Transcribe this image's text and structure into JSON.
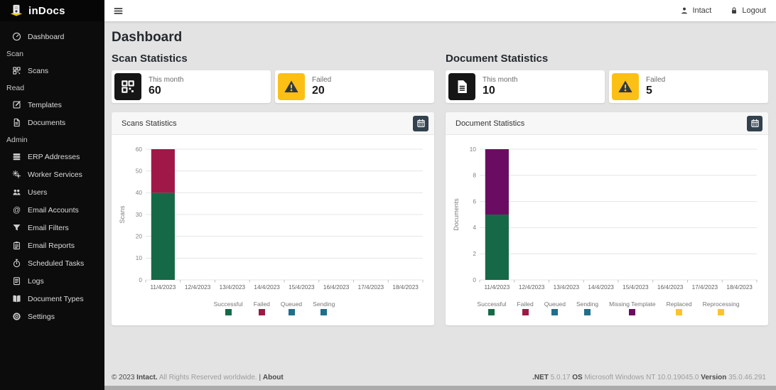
{
  "app": {
    "logo_text": "inDocs"
  },
  "topbar": {
    "user_label": "Intact",
    "logout_label": "Logout"
  },
  "sidebar": {
    "items": [
      {
        "type": "link",
        "label": "Dashboard",
        "icon": "speedometer"
      },
      {
        "type": "section",
        "label": "Scan"
      },
      {
        "type": "link",
        "label": "Scans",
        "icon": "qr-code"
      },
      {
        "type": "section",
        "label": "Read"
      },
      {
        "type": "link",
        "label": "Templates",
        "icon": "pencil-square"
      },
      {
        "type": "link",
        "label": "Documents",
        "icon": "file"
      },
      {
        "type": "section",
        "label": "Admin"
      },
      {
        "type": "link",
        "label": "ERP Addresses",
        "icon": "server"
      },
      {
        "type": "link",
        "label": "Worker Services",
        "icon": "gears"
      },
      {
        "type": "link",
        "label": "Users",
        "icon": "people"
      },
      {
        "type": "link",
        "label": "Email Accounts",
        "icon": "at"
      },
      {
        "type": "link",
        "label": "Email Filters",
        "icon": "funnel"
      },
      {
        "type": "link",
        "label": "Email Reports",
        "icon": "clipboard"
      },
      {
        "type": "link",
        "label": "Scheduled Tasks",
        "icon": "stopwatch"
      },
      {
        "type": "link",
        "label": "Logs",
        "icon": "journal"
      },
      {
        "type": "link",
        "label": "Document Types",
        "icon": "book"
      },
      {
        "type": "link",
        "label": "Settings",
        "icon": "gear"
      }
    ]
  },
  "page": {
    "title": "Dashboard"
  },
  "scan": {
    "heading": "Scan Statistics",
    "cards": [
      {
        "label": "This month",
        "value": "60",
        "icon": "qr-code",
        "icon_bg": "#161616"
      },
      {
        "label": "Failed",
        "value": "20",
        "icon": "warning-triangle",
        "icon_bg": "#fcbf16"
      }
    ],
    "panel_title": "Scans Statistics",
    "panel_button_icon": "calendar"
  },
  "doc": {
    "heading": "Document Statistics",
    "cards": [
      {
        "label": "This month",
        "value": "10",
        "icon": "file-solid",
        "icon_bg": "#161616"
      },
      {
        "label": "Failed",
        "value": "5",
        "icon": "warning-triangle",
        "icon_bg": "#fcbf16"
      }
    ],
    "panel_title": "Document Statistics",
    "panel_button_icon": "calendar"
  },
  "chart_data": [
    {
      "type": "bar",
      "stacked": true,
      "title": "Scans Statistics",
      "xlabel": "",
      "ylabel": "Scans",
      "ylim": [
        0,
        60
      ],
      "yticks": [
        0,
        10,
        20,
        30,
        40,
        50,
        60
      ],
      "grid": true,
      "legend_position": "bottom",
      "categories": [
        "11/4/2023",
        "12/4/2023",
        "13/4/2023",
        "14/4/2023",
        "15/4/2023",
        "16/4/2023",
        "17/4/2023",
        "18/4/2023"
      ],
      "series": [
        {
          "name": "Successful",
          "color": "#156946",
          "values": [
            40,
            0,
            0,
            0,
            0,
            0,
            0,
            0
          ]
        },
        {
          "name": "Failed",
          "color": "#a01847",
          "values": [
            20,
            0,
            0,
            0,
            0,
            0,
            0,
            0
          ]
        },
        {
          "name": "Queued",
          "color": "#1f6e8c",
          "values": [
            0,
            0,
            0,
            0,
            0,
            0,
            0,
            0
          ]
        },
        {
          "name": "Sending",
          "color": "#1f6e8c",
          "values": [
            0,
            0,
            0,
            0,
            0,
            0,
            0,
            0
          ]
        }
      ]
    },
    {
      "type": "bar",
      "stacked": true,
      "title": "Document Statistics",
      "xlabel": "",
      "ylabel": "Documents",
      "ylim": [
        0,
        10
      ],
      "yticks": [
        0,
        2,
        4,
        6,
        8,
        10
      ],
      "grid": true,
      "legend_position": "bottom",
      "categories": [
        "11/4/2023",
        "12/4/2023",
        "13/4/2023",
        "14/4/2023",
        "15/4/2023",
        "16/4/2023",
        "17/4/2023",
        "18/4/2023"
      ],
      "series": [
        {
          "name": "Successful",
          "color": "#156946",
          "values": [
            5,
            0,
            0,
            0,
            0,
            0,
            0,
            0
          ]
        },
        {
          "name": "Failed",
          "color": "#a01847",
          "values": [
            0,
            0,
            0,
            0,
            0,
            0,
            0,
            0
          ]
        },
        {
          "name": "Queued",
          "color": "#1f6e8c",
          "values": [
            0,
            0,
            0,
            0,
            0,
            0,
            0,
            0
          ]
        },
        {
          "name": "Sending",
          "color": "#1f6e8c",
          "values": [
            0,
            0,
            0,
            0,
            0,
            0,
            0,
            0
          ]
        },
        {
          "name": "Missing Template",
          "color": "#6a0d62",
          "values": [
            5,
            0,
            0,
            0,
            0,
            0,
            0,
            0
          ]
        },
        {
          "name": "Replaced",
          "color": "#fcc32c",
          "values": [
            0,
            0,
            0,
            0,
            0,
            0,
            0,
            0
          ]
        },
        {
          "name": "Reprocessing",
          "color": "#fcc32c",
          "values": [
            0,
            0,
            0,
            0,
            0,
            0,
            0,
            0
          ]
        }
      ]
    }
  ],
  "footer": {
    "left": [
      {
        "text": "© 2023 ",
        "dark": true,
        "bold": false
      },
      {
        "text": "Intact.",
        "dark": true,
        "bold": true
      },
      {
        "text": " All Rights Reserved worldwide. ",
        "dark": false,
        "bold": false
      },
      {
        "text": "| ",
        "dark": true,
        "bold": false
      },
      {
        "text": "About",
        "dark": true,
        "bold": true,
        "link": true
      }
    ],
    "right": [
      {
        "text": ".NET",
        "dark": true,
        "bold": true
      },
      {
        "text": " 5.0.17 ",
        "dark": false,
        "bold": false
      },
      {
        "text": "OS",
        "dark": true,
        "bold": true
      },
      {
        "text": " Microsoft Windows NT 10.0.19045.0 ",
        "dark": false,
        "bold": false
      },
      {
        "text": "Version",
        "dark": true,
        "bold": true
      },
      {
        "text": " 35.0.46.291",
        "dark": false,
        "bold": false
      }
    ]
  },
  "colors": {
    "sidebar_bg": "#0c0c0c",
    "accent_yellow": "#fcbf16",
    "card_icon_black": "#161616",
    "panel_button": "#33414e",
    "content_bg": "#e3e3e3"
  }
}
